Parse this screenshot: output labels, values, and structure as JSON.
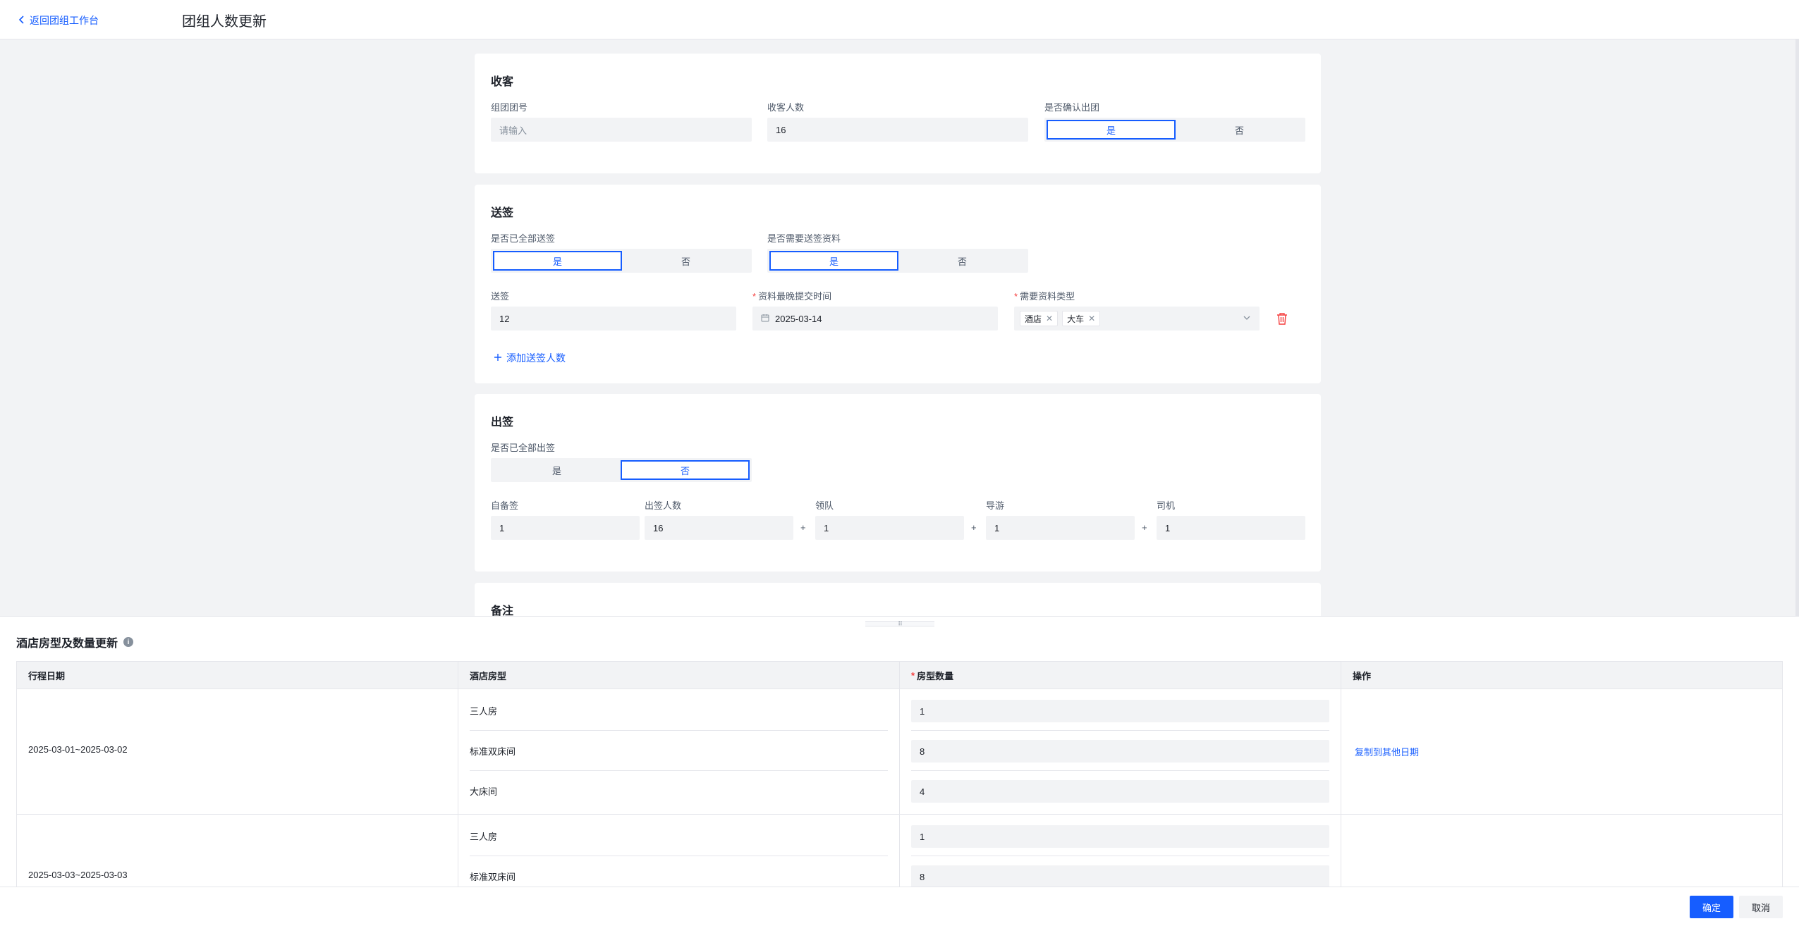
{
  "header": {
    "back_label": "返回团组工作台",
    "title": "团组人数更新"
  },
  "receive": {
    "title": "收客",
    "group_no_label": "组团团号",
    "group_no_placeholder": "请输入",
    "guest_count_label": "收客人数",
    "guest_count_value": "16",
    "confirm_label": "是否确认出团",
    "yes": "是",
    "no": "否",
    "selected": "是"
  },
  "submit_visa": {
    "title": "送签",
    "all_sent_label": "是否已全部送签",
    "need_docs_label": "是否需要送签资料",
    "yes": "是",
    "no": "否",
    "all_sent_selected": "是",
    "need_docs_selected": "是",
    "count_label": "送签",
    "count_value": "12",
    "deadline_label": "资料最晚提交时间",
    "deadline_value": "2025-03-14",
    "doc_type_label": "需要资料类型",
    "doc_types": [
      "酒店",
      "大车"
    ],
    "add_link": "添加送签人数"
  },
  "issue_visa": {
    "title": "出签",
    "all_issued_label": "是否已全部出签",
    "yes": "是",
    "no": "否",
    "selected": "否",
    "self_label": "自备签",
    "self_value": "1",
    "issued_label": "出签人数",
    "issued_value": "16",
    "leader_label": "领队",
    "leader_value": "1",
    "guide_label": "导游",
    "guide_value": "1",
    "driver_label": "司机",
    "driver_value": "1",
    "plus": "+"
  },
  "remark": {
    "title": "备注"
  },
  "drawer": {
    "handle": "⠿",
    "title": "酒店房型及数量更新",
    "info_glyph": "i",
    "columns": [
      "行程日期",
      "酒店房型",
      "房型数量",
      "操作"
    ],
    "rows": [
      {
        "date": "2025-03-01~2025-03-02",
        "rooms": [
          {
            "type": "三人房",
            "qty": "1"
          },
          {
            "type": "标准双床间",
            "qty": "8"
          },
          {
            "type": "大床间",
            "qty": "4"
          }
        ],
        "action": "复制到其他日期"
      },
      {
        "date": "2025-03-03~2025-03-03",
        "rooms": [
          {
            "type": "三人房",
            "qty": "1"
          },
          {
            "type": "标准双床间",
            "qty": "8"
          }
        ]
      }
    ]
  },
  "footer": {
    "confirm": "确定",
    "cancel": "取消"
  },
  "colors": {
    "primary": "#165dff",
    "required": "#f53f3f",
    "danger": "#f53f3f",
    "background": "#f2f3f5"
  },
  "icons": [
    "chevron-left-icon",
    "calendar-icon",
    "close-icon",
    "chevron-down-icon",
    "trash-icon",
    "plus-icon",
    "info-icon",
    "drag-handle-icon"
  ]
}
